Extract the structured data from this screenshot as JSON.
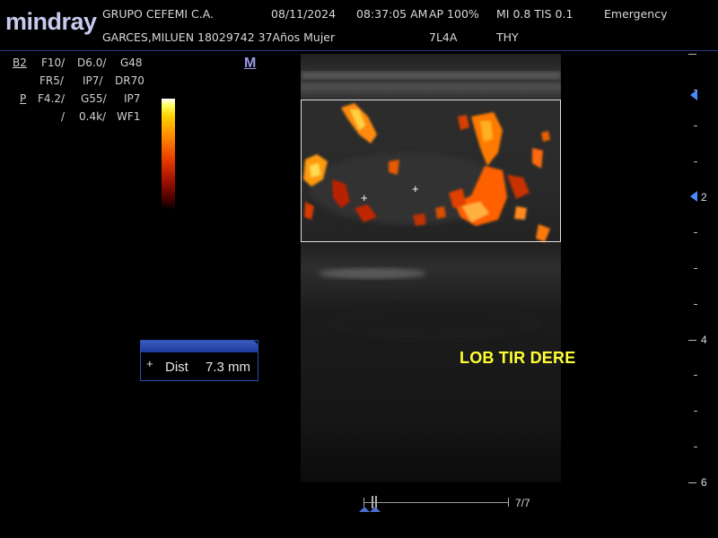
{
  "logo": "mindray",
  "header": {
    "clinic": "GRUPO CEFEMI C.A.",
    "date": "08/11/2024",
    "time": "08:37:05 AM",
    "ap": "AP  100%",
    "mi_tis": "MI 0.8 TIS 0.1",
    "mode": "Emergency",
    "patient": "GARCES,MILUEN 18029742 37Años Mujer",
    "probe": "7L4A",
    "preset": "THY"
  },
  "params": {
    "b2": "B2",
    "f10": "F10/",
    "d60": "D6.0/",
    "g48": "G48",
    "fr5": "FR5/",
    "ip7a": "IP7/",
    "dr70": "DR70",
    "p": "P",
    "f42": "F4.2/",
    "g55": "G55/",
    "ip7b": "IP7",
    "slash": "/",
    "prf": "0.4k/",
    "wf1": "WF1"
  },
  "mode_marker": "M",
  "measurement": {
    "label": "Dist",
    "value": "7.3 mm"
  },
  "annotation": "LOB TIR DERE",
  "depth_labels": [
    "2",
    "4",
    "6"
  ],
  "cine": {
    "frames": "7/7"
  },
  "colors": {
    "logo": "#c9c9ef",
    "annotation": "#ffff33",
    "focus_marker": "#4a8cff",
    "measure_box": "#2c4db0"
  }
}
